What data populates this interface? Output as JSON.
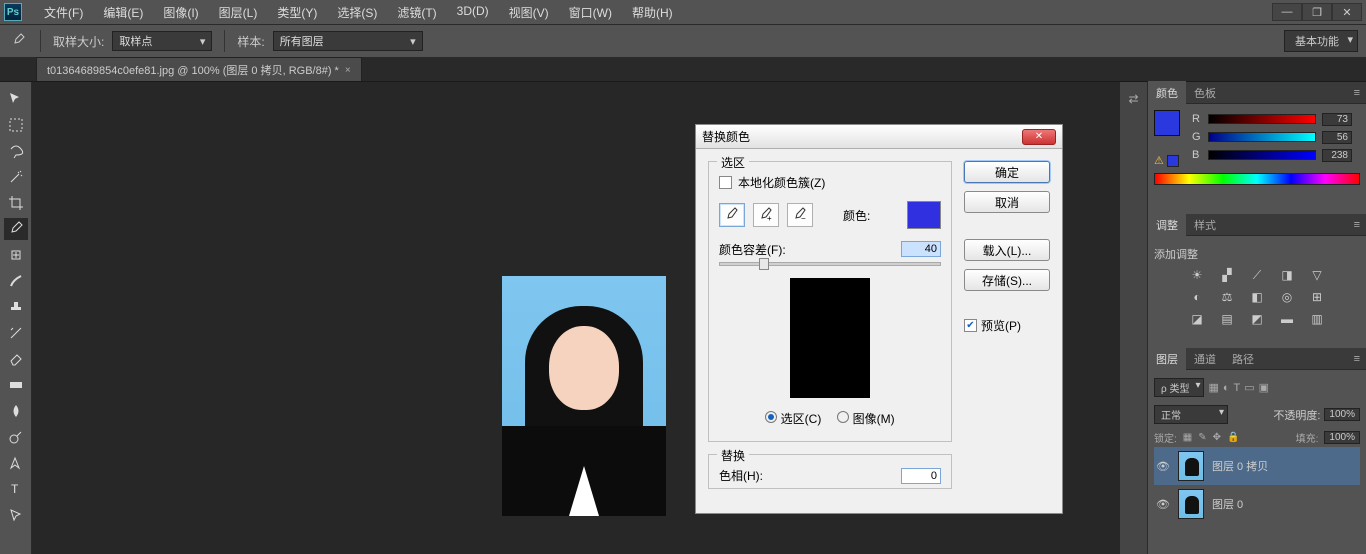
{
  "menubar": {
    "items": [
      "文件(F)",
      "编辑(E)",
      "图像(I)",
      "图层(L)",
      "类型(Y)",
      "选择(S)",
      "滤镜(T)",
      "3D(D)",
      "视图(V)",
      "窗口(W)",
      "帮助(H)"
    ]
  },
  "optbar": {
    "sample_size_label": "取样大小:",
    "sample_size_value": "取样点",
    "sample_label": "样本:",
    "sample_value": "所有图层",
    "workspace": "基本功能"
  },
  "doc_tab": {
    "title": "t01364689854c0efe81.jpg @ 100% (图层 0 拷贝, RGB/8#) *"
  },
  "color_panel": {
    "tabs": [
      "颜色",
      "色板"
    ],
    "r": {
      "label": "R",
      "value": "73"
    },
    "g": {
      "label": "G",
      "value": "56"
    },
    "b": {
      "label": "B",
      "value": "238"
    }
  },
  "adjust_panel": {
    "tabs": [
      "调整",
      "样式"
    ],
    "title": "添加调整"
  },
  "layers_panel": {
    "tabs": [
      "图层",
      "通道",
      "路径"
    ],
    "kind_label": "ρ 类型",
    "blend_mode": "正常",
    "opacity_label": "不透明度:",
    "opacity_value": "100%",
    "lock_label": "锁定:",
    "fill_label": "填充:",
    "fill_value": "100%",
    "layers": [
      {
        "name": "图层 0 拷贝"
      },
      {
        "name": "图层 0"
      }
    ]
  },
  "dialog": {
    "title": "替换颜色",
    "group_select": "选区",
    "localize": "本地化颜色簇(Z)",
    "color_label": "颜色:",
    "fuzz_label": "颜色容差(F):",
    "fuzz_value": "40",
    "radio_select": "选区(C)",
    "radio_image": "图像(M)",
    "group_replace": "替换",
    "hue_label": "色相(H):",
    "hue_value": "0",
    "buttons": {
      "ok": "确定",
      "cancel": "取消",
      "load": "载入(L)...",
      "save": "存储(S)...",
      "preview": "预览(P)"
    }
  }
}
